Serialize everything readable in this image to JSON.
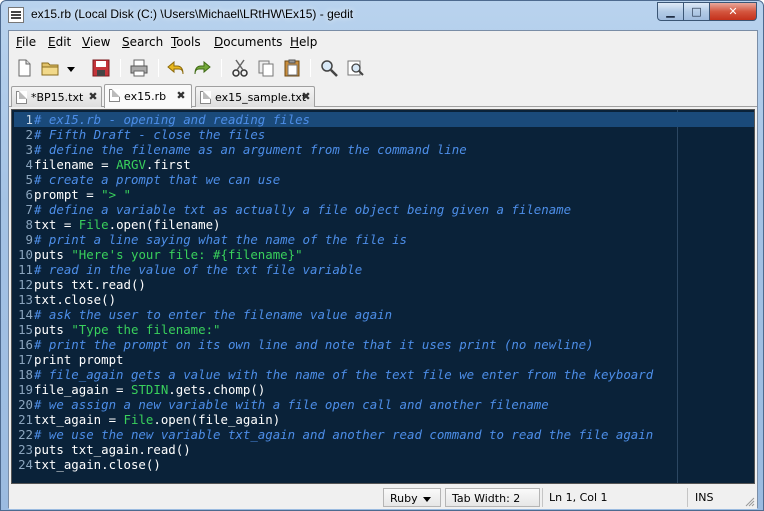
{
  "window": {
    "title": "ex15.rb (Local Disk (C:) \\Users\\Michael\\LRtHW\\Ex15) - gedit",
    "min_glyph": "▁",
    "max_glyph": "□",
    "close_glyph": "✕"
  },
  "menu": [
    {
      "u": "F",
      "rest": "ile"
    },
    {
      "u": "E",
      "rest": "dit"
    },
    {
      "u": "V",
      "rest": "iew"
    },
    {
      "u": "S",
      "rest": "earch"
    },
    {
      "u": "T",
      "rest": "ools"
    },
    {
      "u": "D",
      "rest": "ocuments"
    },
    {
      "u": "H",
      "rest": "elp"
    }
  ],
  "toolbar_icons": [
    "new-file-icon",
    "open-folder-icon",
    "dropdown-arrow-icon",
    "save-icon",
    "print-icon",
    "undo-icon",
    "redo-icon",
    "cut-icon",
    "copy-icon",
    "paste-icon",
    "find-icon",
    "replace-icon"
  ],
  "tabs": [
    {
      "label": "*BP15.txt",
      "active": false
    },
    {
      "label": "ex15.rb",
      "active": true
    },
    {
      "label": "ex15_sample.txt",
      "active": false
    }
  ],
  "code": [
    [
      [
        "c",
        "# ex15.rb - opening and reading files"
      ]
    ],
    [
      [
        "c",
        "# Fifth Draft - close the files"
      ]
    ],
    [
      [
        "c",
        "# define the filename as an argument from the command line"
      ]
    ],
    [
      [
        "p",
        "filename = "
      ],
      [
        "k",
        "ARGV"
      ],
      [
        "p",
        ".first"
      ]
    ],
    [
      [
        "c",
        "# create a prompt that we can use"
      ]
    ],
    [
      [
        "p",
        "prompt = "
      ],
      [
        "s",
        "\"> \""
      ]
    ],
    [
      [
        "c",
        "# define a variable txt as actually a file object being given a filename"
      ]
    ],
    [
      [
        "p",
        "txt = "
      ],
      [
        "k",
        "File"
      ],
      [
        "p",
        ".open(filename)"
      ]
    ],
    [
      [
        "c",
        "# print a line saying what the name of the file is"
      ]
    ],
    [
      [
        "p",
        "puts "
      ],
      [
        "s",
        "\"Here's your file: #{filename}\""
      ]
    ],
    [
      [
        "c",
        "# read in the value of the txt file variable"
      ]
    ],
    [
      [
        "p",
        "puts txt.read()"
      ]
    ],
    [
      [
        "p",
        "txt.close()"
      ]
    ],
    [
      [
        "c",
        "# ask the user to enter the filename value again"
      ]
    ],
    [
      [
        "p",
        "puts "
      ],
      [
        "s",
        "\"Type the filename:\""
      ]
    ],
    [
      [
        "c",
        "# print the prompt on its own line and note that it uses print (no newline)"
      ]
    ],
    [
      [
        "p",
        "print prompt"
      ]
    ],
    [
      [
        "c",
        "# file_again gets a value with the name of the text file we enter from the keyboard"
      ]
    ],
    [
      [
        "p",
        "file_again = "
      ],
      [
        "k",
        "STDIN"
      ],
      [
        "p",
        ".gets.chomp()"
      ]
    ],
    [
      [
        "c",
        "# we assign a new variable with a file open call and another filename"
      ]
    ],
    [
      [
        "p",
        "txt_again = "
      ],
      [
        "k",
        "File"
      ],
      [
        "p",
        ".open(file_again)"
      ]
    ],
    [
      [
        "c",
        "# we use the new variable txt_again and another read command to read the file again"
      ]
    ],
    [
      [
        "p",
        "puts txt_again.read()"
      ]
    ],
    [
      [
        "p",
        "txt_again.close()"
      ]
    ]
  ],
  "status": {
    "language": "Ruby",
    "tab_width": "Tab Width: 2",
    "position": "Ln 1, Col 1",
    "mode": "INS"
  },
  "colors": {
    "editor_bg": "#0a2239",
    "comment": "#4d8ee8",
    "string": "#39d05c",
    "current_line": "#1a4a7a"
  }
}
